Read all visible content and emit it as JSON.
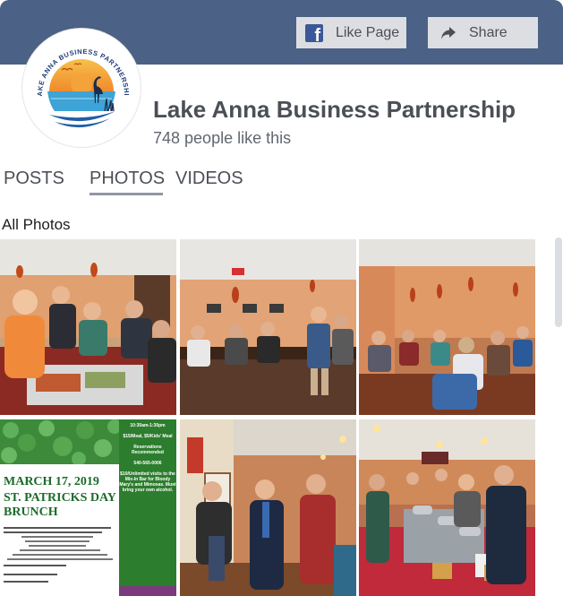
{
  "header": {
    "like_button": {
      "label": "Like Page",
      "icon": "facebook-icon"
    },
    "share_button": {
      "label": "Share",
      "icon": "share-arrow-icon"
    },
    "logo": {
      "text": "LAKE ANNA BUSINESS PARTNERSHIP"
    }
  },
  "page": {
    "name": "Lake Anna Business Partnership",
    "likes": "748 people like this"
  },
  "tabs": [
    {
      "label": "POSTS",
      "active": false
    },
    {
      "label": "PHOTOS",
      "active": true
    },
    {
      "label": "VIDEOS",
      "active": false
    }
  ],
  "section_title": "All Photos",
  "flyer": {
    "date": "MARCH 17, 2019",
    "title": "ST. PATRICKS DAY BRUNCH",
    "right_lines": [
      "10:30am-1:30pm",
      "$15/Meal, $5/Kids' Meal",
      "Reservations Recommended",
      "540-565-0006",
      "$10/Unlimited visits to the Mix-In Bar for Bloody Mary's and Mimosas. Must bring your own alcohol."
    ]
  },
  "colors": {
    "header_bg": "#4b6185",
    "button_bg": "#dcdee2",
    "facebook_blue": "#3b5998",
    "flyer_green": "#2d7d2e"
  }
}
